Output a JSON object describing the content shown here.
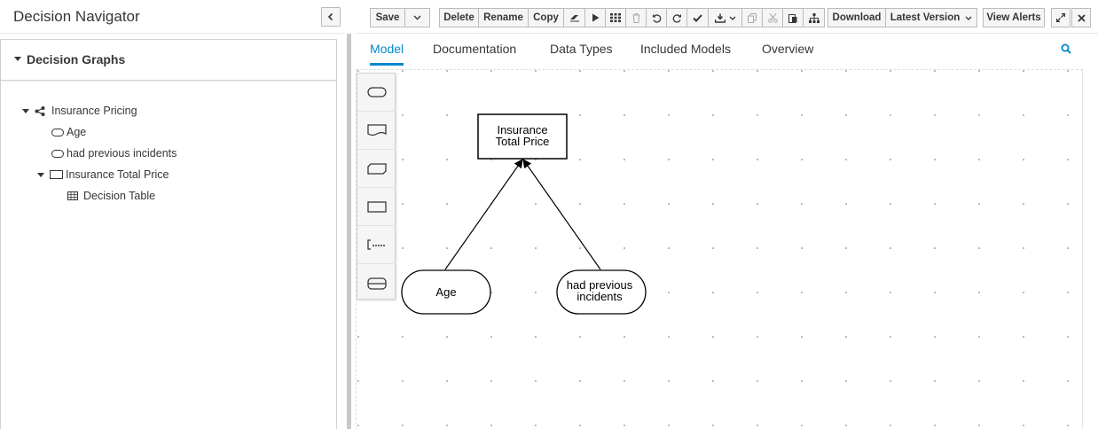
{
  "navigator": {
    "title": "Decision Navigator",
    "panel_title": "Decision Graphs",
    "tree": [
      {
        "label": "Insurance Pricing",
        "icon": "graph-icon"
      },
      {
        "label": "Age",
        "icon": "input-data-icon"
      },
      {
        "label": "had previous incidents",
        "icon": "input-data-icon"
      },
      {
        "label": "Insurance Total Price",
        "icon": "decision-icon"
      },
      {
        "label": "Decision Table",
        "icon": "table-icon"
      }
    ]
  },
  "toolbar": {
    "save": "Save",
    "delete": "Delete",
    "rename": "Rename",
    "copy": "Copy",
    "download": "Download",
    "latest_version": "Latest Version",
    "view_alerts": "View Alerts"
  },
  "tabs": [
    {
      "label": "Model",
      "active": true
    },
    {
      "label": "Documentation"
    },
    {
      "label": "Data Types"
    },
    {
      "label": "Included Models"
    },
    {
      "label": "Overview"
    }
  ],
  "diagram": {
    "decision": {
      "line1": "Insurance",
      "line2": "Total Price"
    },
    "input_age": {
      "label": "Age"
    },
    "input_incidents": {
      "line1": "had previous",
      "line2": "incidents"
    }
  },
  "colors": {
    "accent": "#0088ce",
    "text": "#363636"
  }
}
